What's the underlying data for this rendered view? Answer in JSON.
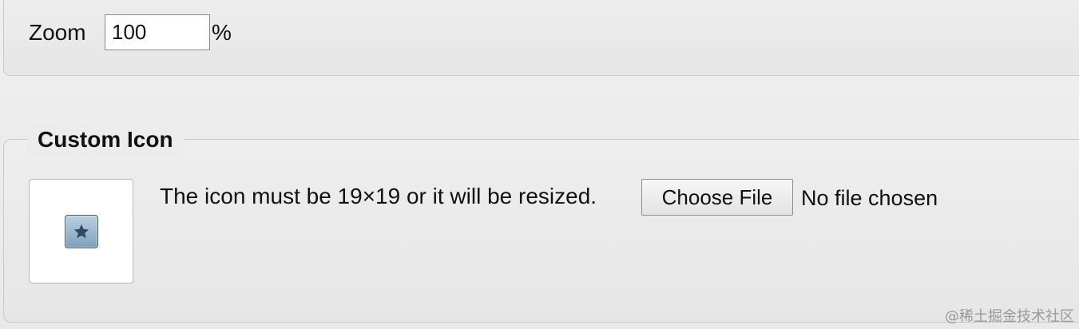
{
  "zoom": {
    "label": "Zoom",
    "value": "100",
    "unit": "%"
  },
  "custom_icon": {
    "legend": "Custom Icon",
    "preview_icon": "star-icon",
    "hint": "The icon must be 19×19 or it will be resized.",
    "choose_file_label": "Choose File",
    "file_status": "No file chosen"
  },
  "watermark": "@稀土掘金技术社区",
  "colors": {
    "background": "#ececec",
    "icon_fill": "#7fa0bb",
    "icon_star": "#2f4a63"
  }
}
